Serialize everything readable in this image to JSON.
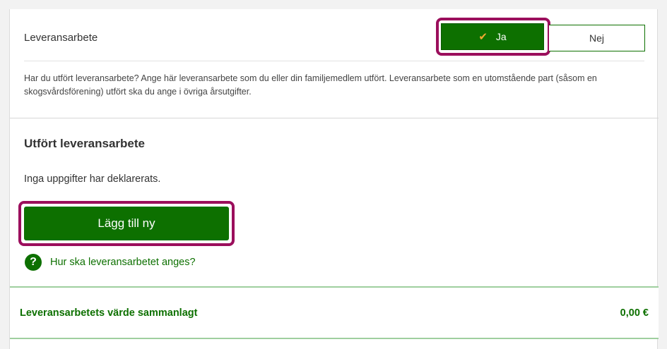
{
  "delivery_work": {
    "label": "Leveransarbete",
    "yes_label": "Ja",
    "no_label": "Nej",
    "selected": "Ja",
    "help_text": "Har du utfört leveransarbete? Ange här leveransarbete som du eller din familjemedlem utfört. Leveransarbete som en utomstående part (såsom en skogsvårdsförening) utfört ska du ange i övriga årsutgifter."
  },
  "performed": {
    "title": "Utfört leveransarbete",
    "no_data_text": "Inga uppgifter har deklarerats.",
    "add_button_label": "Lägg till ny",
    "help_link_text": "Hur ska leveransarbetet anges?",
    "help_icon_glyph": "?"
  },
  "summary": {
    "label": "Leveransarbetets värde sammanlagt",
    "value": "0,00 €"
  },
  "colors": {
    "primary_green": "#0d7000",
    "highlight_border": "#9b0e5c",
    "check_orange": "#f0a830"
  },
  "icons": {
    "check": "check-icon",
    "help": "question-circle-icon"
  }
}
